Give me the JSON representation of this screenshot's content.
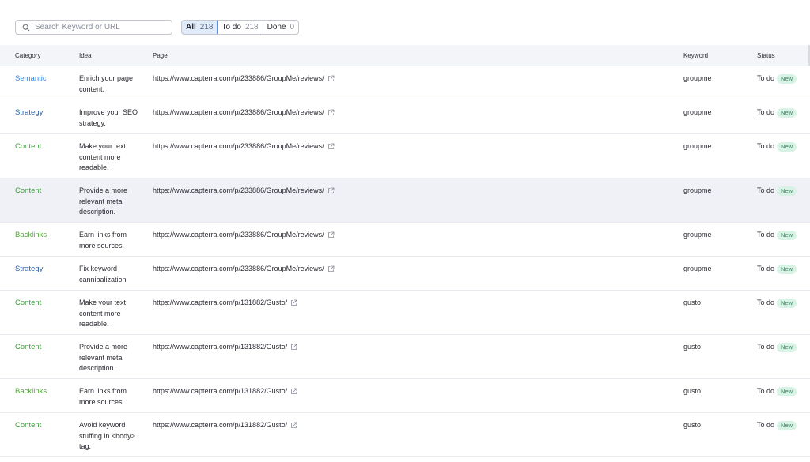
{
  "search": {
    "placeholder": "Search Keyword or URL",
    "value": ""
  },
  "filters": [
    {
      "label": "All",
      "count": "218"
    },
    {
      "label": "To do",
      "count": "218"
    },
    {
      "label": "Done",
      "count": "0"
    }
  ],
  "columns": {
    "category": "Category",
    "idea": "Idea",
    "page": "Page",
    "keyword": "Keyword",
    "status": "Status"
  },
  "colors": {
    "semantic": "#3a86e0",
    "strategy": "#2f5fa8",
    "content": "#3f9b3f",
    "backlinks": "#56a33d",
    "badge_bg": "#d8f3e6",
    "badge_text": "#2f8a5e"
  },
  "rows": [
    {
      "category": "Semantic",
      "idea": "Enrich your page content.",
      "page": "https://www.capterra.com/p/233886/GroupMe/reviews/",
      "keyword": "groupme",
      "status": "To do",
      "badge": "New"
    },
    {
      "category": "Strategy",
      "idea": "Improve your SEO strategy.",
      "page": "https://www.capterra.com/p/233886/GroupMe/reviews/",
      "keyword": "groupme",
      "status": "To do",
      "badge": "New"
    },
    {
      "category": "Content",
      "idea": "Make your text content more readable.",
      "page": "https://www.capterra.com/p/233886/GroupMe/reviews/",
      "keyword": "groupme",
      "status": "To do",
      "badge": "New"
    },
    {
      "category": "Content",
      "idea": "Provide a more relevant meta description.",
      "page": "https://www.capterra.com/p/233886/GroupMe/reviews/",
      "keyword": "groupme",
      "status": "To do",
      "badge": "New"
    },
    {
      "category": "Backlinks",
      "idea": "Earn links from more sources.",
      "page": "https://www.capterra.com/p/233886/GroupMe/reviews/",
      "keyword": "groupme",
      "status": "To do",
      "badge": "New"
    },
    {
      "category": "Strategy",
      "idea": "Fix keyword cannibalization",
      "page": "https://www.capterra.com/p/233886/GroupMe/reviews/",
      "keyword": "groupme",
      "status": "To do",
      "badge": "New"
    },
    {
      "category": "Content",
      "idea": "Make your text content more readable.",
      "page": "https://www.capterra.com/p/131882/Gusto/",
      "keyword": "gusto",
      "status": "To do",
      "badge": "New"
    },
    {
      "category": "Content",
      "idea": "Provide a more relevant meta description.",
      "page": "https://www.capterra.com/p/131882/Gusto/",
      "keyword": "gusto",
      "status": "To do",
      "badge": "New"
    },
    {
      "category": "Backlinks",
      "idea": "Earn links from more sources.",
      "page": "https://www.capterra.com/p/131882/Gusto/",
      "keyword": "gusto",
      "status": "To do",
      "badge": "New"
    },
    {
      "category": "Content",
      "idea": "Avoid keyword stuffing in <body> tag.",
      "page": "https://www.capterra.com/p/131882/Gusto/",
      "keyword": "gusto",
      "status": "To do",
      "badge": "New"
    }
  ]
}
